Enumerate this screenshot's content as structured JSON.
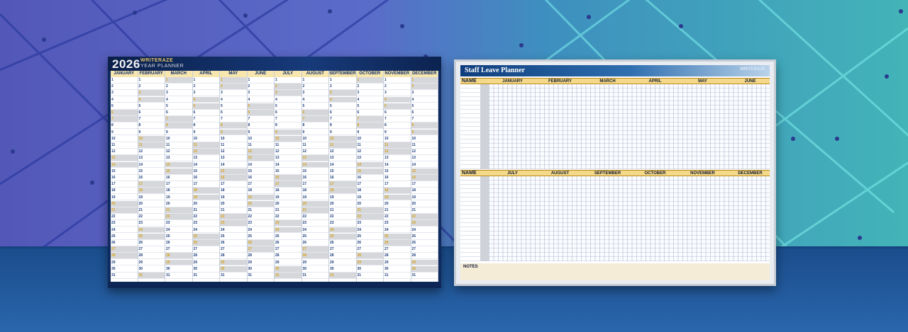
{
  "scene": {
    "description_free": true,
    "colors": {
      "wall_left": "#5b63c4",
      "wall_right": "#36a7b6",
      "shelf": "#1e5494",
      "floor": "#2462a8"
    }
  },
  "year_planner": {
    "year": "2026",
    "brand": "WRITERAZE",
    "subtitle": "YEAR PLANNER",
    "months": [
      "JANUARY",
      "FEBRUARY",
      "MARCH",
      "APRIL",
      "MAY",
      "JUNE",
      "JULY",
      "AUGUST",
      "SEPTEMBER",
      "OCTOBER",
      "NOVEMBER",
      "DECEMBER"
    ]
  },
  "staff_leave_planner": {
    "title": "Staff Leave Planner",
    "logo": "WRITERAZE",
    "name_label": "NAME",
    "months_top": [
      "JANUARY",
      "FEBRUARY",
      "MARCH",
      "APRIL",
      "MAY",
      "JUNE"
    ],
    "months_bottom": [
      "JULY",
      "AUGUST",
      "SEPTEMBER",
      "OCTOBER",
      "NOVEMBER",
      "DECEMBER"
    ],
    "notes_label": "NOTES"
  }
}
